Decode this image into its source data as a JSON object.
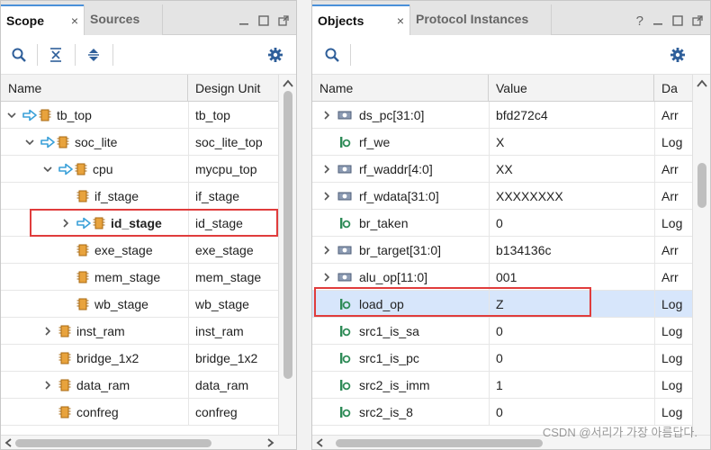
{
  "colors": {
    "accent": "#4a90d9",
    "highlight_box": "#e03c3c",
    "selected_row": "#d7e6fb",
    "module_icon": "#e8a33d",
    "arrow_icon": "#3aa0d8",
    "signal_icon": "#2e8b57"
  },
  "left": {
    "tabs": [
      {
        "label": "Scope",
        "active": true
      },
      {
        "label": "Sources",
        "active": false
      }
    ],
    "close_glyph": "×",
    "columns": [
      "Name",
      "Design Unit"
    ],
    "rows": [
      {
        "name": "tb_top",
        "unit": "tb_top"
      },
      {
        "name": "soc_lite",
        "unit": "soc_lite_top"
      },
      {
        "name": "cpu",
        "unit": "mycpu_top"
      },
      {
        "name": "if_stage",
        "unit": "if_stage"
      },
      {
        "name": "id_stage",
        "unit": "id_stage"
      },
      {
        "name": "exe_stage",
        "unit": "exe_stage"
      },
      {
        "name": "mem_stage",
        "unit": "mem_stage"
      },
      {
        "name": "wb_stage",
        "unit": "wb_stage"
      },
      {
        "name": "inst_ram",
        "unit": "inst_ram"
      },
      {
        "name": "bridge_1x2",
        "unit": "bridge_1x2"
      },
      {
        "name": "data_ram",
        "unit": "data_ram"
      },
      {
        "name": "confreg",
        "unit": "confreg"
      }
    ]
  },
  "right": {
    "tabs": [
      {
        "label": "Objects",
        "active": true
      },
      {
        "label": "Protocol Instances",
        "active": false
      }
    ],
    "close_glyph": "×",
    "help_glyph": "?",
    "columns": [
      "Name",
      "Value",
      "Da"
    ],
    "rows": [
      {
        "name": "ds_pc[31:0]",
        "value": "bfd272c4",
        "type": "Arr"
      },
      {
        "name": "rf_we",
        "value": "X",
        "type": "Log"
      },
      {
        "name": "rf_waddr[4:0]",
        "value": "XX",
        "type": "Arr"
      },
      {
        "name": "rf_wdata[31:0]",
        "value": "XXXXXXXX",
        "type": "Arr"
      },
      {
        "name": "br_taken",
        "value": "0",
        "type": "Log"
      },
      {
        "name": "br_target[31:0]",
        "value": "b134136c",
        "type": "Arr"
      },
      {
        "name": "alu_op[11:0]",
        "value": "001",
        "type": "Arr"
      },
      {
        "name": "load_op",
        "value": "Z",
        "type": "Log"
      },
      {
        "name": "src1_is_sa",
        "value": "0",
        "type": "Log"
      },
      {
        "name": "src1_is_pc",
        "value": "0",
        "type": "Log"
      },
      {
        "name": "src2_is_imm",
        "value": "1",
        "type": "Log"
      },
      {
        "name": "src2_is_8",
        "value": "0",
        "type": "Log"
      }
    ]
  },
  "watermark": "CSDN @서리가 가장 아름답다."
}
